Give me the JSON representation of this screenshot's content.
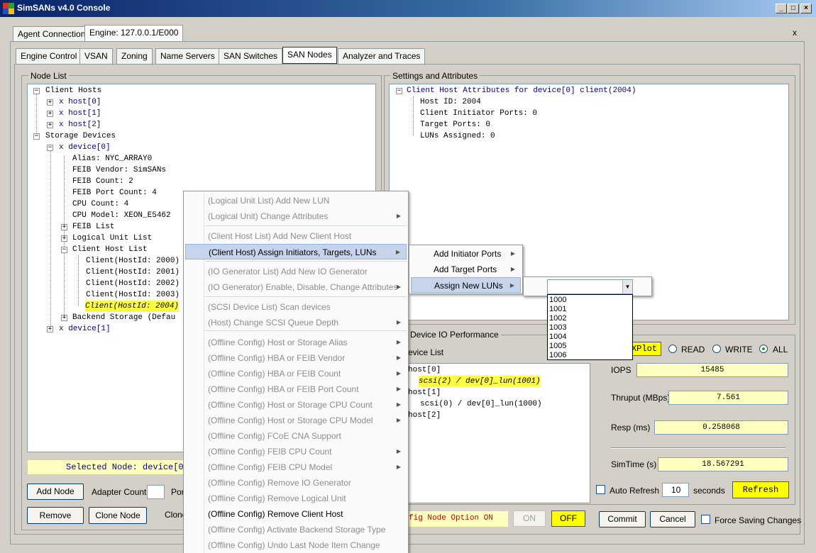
{
  "window": {
    "title": "SimSANs v4.0 Console",
    "close_label": "x"
  },
  "top_tabs": [
    "Agent Connections",
    "Engine: 127.0.0.1/E000"
  ],
  "sub_tabs": [
    "Engine Control",
    "VSAN",
    "Zoning",
    "Name Servers",
    "SAN Switches",
    "SAN Nodes",
    "Analyzer and Traces"
  ],
  "node_list": {
    "title": "Node List",
    "tree": [
      "Client Hosts",
      "x host[0]",
      "x host[1]",
      "x host[2]",
      "Storage Devices",
      "x device[0]",
      "Alias: NYC_ARRAY0",
      "FEIB Vendor: SimSANs",
      "FEIB Count: 2",
      "FEIB Port Count: 4",
      "CPU Count: 4",
      "CPU Model: XEON_E5462",
      "FEIB List",
      "Logical Unit List",
      "Client Host List",
      "Client(HostId: 2000)",
      "Client(HostId: 2001)",
      "Client(HostId: 2002)",
      "Client(HostId: 2003)",
      "Client(HostId: 2004)",
      "Backend Storage (Defau",
      "x device[1]"
    ],
    "selected_node": "Selected Node: device[0]",
    "add_node": "Add Node",
    "adapter_count": "Adapter Count",
    "adapter_count_value": "",
    "port_label": "Por",
    "remove": "Remove",
    "clone_node": "Clone Node",
    "clone_label": "Clone"
  },
  "settings": {
    "title": "Settings and Attributes",
    "tree": [
      "Client Host Attributes for device[0] client(2004)",
      "Host ID: 2004",
      "Client Initiator Ports: 0",
      "Target Ports: 0",
      "LUNs Assigned: 0"
    ]
  },
  "perf": {
    "title": "Device IO Performance",
    "device_list_label": "evice List",
    "devices": [
      "host[0]",
      "scsi(2) / dev[0]_lun(1001)",
      "host[1]",
      "scsi(0) / dev[0]_lun(1000)",
      "host[2]"
    ],
    "xplot": "XPlot",
    "read": "READ",
    "write": "WRITE",
    "all": "ALL",
    "selected_mode": "ALL",
    "iops_label": "IOPS",
    "iops": "15485",
    "thruput_label": "Thruput (MBps)",
    "thruput": "7.561",
    "resp_label": "Resp (ms)",
    "resp": "0.258068",
    "simtime_label": "SimTime (s)",
    "simtime": "18.567291",
    "auto_refresh": "Auto Refresh",
    "refresh_value": "10",
    "seconds": "seconds",
    "refresh": "Refresh"
  },
  "bottom": {
    "config_option": "fig Node Option ON",
    "on": "ON",
    "off": "OFF",
    "commit": "Commit",
    "cancel": "Cancel",
    "force_saving": "Force Saving Changes"
  },
  "context_menu": {
    "items": [
      "(Logical Unit List) Add New LUN",
      "(Logical Unit) Change Attributes",
      "(Client Host List) Add New Client Host",
      "(Client Host) Assign Initiators, Targets, LUNs",
      "(IO Generator List) Add New IO Generator",
      "(IO Generator) Enable, Disable, Change Attributes",
      "(SCSI Device List) Scan devices",
      "(Host) Change SCSI Queue Depth",
      "(Offline Config) Host or Storage Alias",
      "(Offline Config) HBA or FEIB Vendor",
      "(Offline Config) HBA or FEIB Count",
      "(Offline Config) HBA or FEIB Port Count",
      "(Offline Config) Host or Storage CPU Count",
      "(Offline Config) Host or Storage CPU Model",
      "(Offline Config) FCoE CNA Support",
      "(Offline Config) FEIB CPU Count",
      "(Offline Config) FEIB CPU Model",
      "(Offline Config) Remove IO Generator",
      "(Offline Config) Remove Logical Unit",
      "(Offline Config) Remove Client Host",
      "(Offline Config) Activate Backend Storage Type",
      "(Offline Config) Undo Last Node Item Change"
    ]
  },
  "submenu": {
    "items": [
      "Add Initiator Ports",
      "Add Target Ports",
      "Assign New LUNs"
    ]
  },
  "lun_dropdown": {
    "value": "",
    "options": [
      "1000",
      "1001",
      "1002",
      "1003",
      "1004",
      "1005",
      "1006"
    ]
  }
}
